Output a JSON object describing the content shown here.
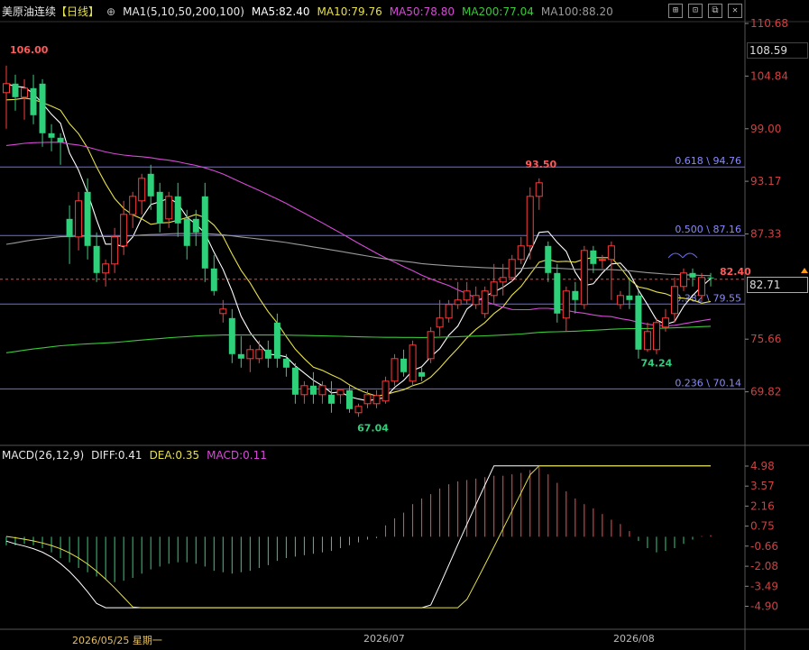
{
  "header": {
    "symbol": "美原油连续",
    "period": "【日线】",
    "settings_icon": "circle-plus-icon",
    "ma_set": "MA1(5,10,50,200,100)",
    "ma5": "MA5:82.40",
    "ma10": "MA10:79.76",
    "ma50": "MA50:78.80",
    "ma200": "MA200:77.04",
    "ma100": "MA100:88.20",
    "colors": {
      "ma5": "#ffffff",
      "ma10": "#e6e04a",
      "ma50": "#d64bd6",
      "ma200": "#39c939",
      "ma100": "#9a9a9a"
    }
  },
  "toolbar": [
    {
      "icon": "grid-icon",
      "label": "⊞"
    },
    {
      "icon": "window-icon",
      "label": "⊡"
    },
    {
      "icon": "dock-icon",
      "label": "⧉"
    },
    {
      "icon": "close-icon",
      "label": "✕"
    }
  ],
  "macd_header": {
    "name": "MACD(26,12,9)",
    "diff": "DIFF:0.41",
    "dea": "DEA:0.35",
    "macd": "MACD:0.11"
  },
  "price_axis": [
    "110.68",
    "104.84",
    "99.00",
    "93.17",
    "87.33",
    "75.66",
    "69.82"
  ],
  "price_boxes": {
    "upper": "108.59",
    "current": "82.71"
  },
  "macd_axis": [
    "4.98",
    "3.57",
    "2.16",
    "0.75",
    "-0.66",
    "-2.08",
    "-3.49",
    "-4.90"
  ],
  "x_labels": [
    "2026/05/25 星期一",
    "2026/07",
    "2026/08"
  ],
  "fib_levels": [
    {
      "label": "0.618 \\ 94.76",
      "value": 94.76
    },
    {
      "label": "0.500 \\ 87.16",
      "value": 87.16
    },
    {
      "label": "0.382 \\ 79.55",
      "value": 79.55
    },
    {
      "label": "0.236 \\ 70.14",
      "value": 70.14
    }
  ],
  "annotations": [
    {
      "label": "106.00",
      "value": 106.0
    },
    {
      "label": "93.50",
      "value": 93.5
    },
    {
      "label": "67.04",
      "value": 67.04
    },
    {
      "label": "74.24",
      "value": 74.24
    },
    {
      "label": "82.40",
      "value": 82.4
    }
  ],
  "chart_data": {
    "type": "candlestick",
    "ylim": [
      67.04,
      110.68
    ],
    "candles": [
      [
        103,
        106,
        99,
        104
      ],
      [
        104,
        105,
        101,
        102.5
      ],
      [
        102.5,
        104.5,
        100,
        103.5
      ],
      [
        103.5,
        105,
        99.5,
        100.5
      ],
      [
        104,
        104.5,
        97,
        98.5
      ],
      [
        98.5,
        99.5,
        96.5,
        98
      ],
      [
        98,
        98.5,
        95,
        97.5
      ],
      [
        89,
        90.5,
        84,
        87
      ],
      [
        87,
        92,
        85.5,
        91
      ],
      [
        92,
        93.5,
        84.5,
        86
      ],
      [
        86,
        87.5,
        82,
        83
      ],
      [
        83,
        84.5,
        81.5,
        84
      ],
      [
        84,
        88,
        83,
        87
      ],
      [
        86,
        91,
        85,
        89.5
      ],
      [
        89.5,
        92,
        88,
        91.5
      ],
      [
        91,
        94,
        89.5,
        93.5
      ],
      [
        94,
        95,
        90,
        91.5
      ],
      [
        92,
        93,
        87.5,
        88.5
      ],
      [
        89,
        92,
        88,
        91.5
      ],
      [
        91.5,
        93,
        87,
        88.5
      ],
      [
        89,
        90,
        84.5,
        86
      ],
      [
        89,
        90,
        86,
        87.5
      ],
      [
        91.5,
        93,
        82,
        83.5
      ],
      [
        83.5,
        85,
        80.5,
        81
      ],
      [
        78.5,
        80,
        77.5,
        79
      ],
      [
        78,
        79,
        73,
        74
      ],
      [
        74,
        76,
        72.5,
        73.5
      ],
      [
        73.5,
        75,
        72,
        74.5
      ],
      [
        73.5,
        75.5,
        73,
        74.5
      ],
      [
        74.5,
        75.5,
        72.5,
        73.5
      ],
      [
        77.5,
        78.5,
        72.5,
        73.5
      ],
      [
        73.5,
        74,
        71.5,
        72.5
      ],
      [
        72.5,
        73,
        68.5,
        69.5
      ],
      [
        69.5,
        71,
        68.5,
        70.5
      ],
      [
        70.5,
        72,
        68.5,
        69.5
      ],
      [
        69.5,
        71,
        68.5,
        70.5
      ],
      [
        69.5,
        71,
        67.5,
        68.5
      ],
      [
        69.5,
        70,
        68.5,
        70
      ],
      [
        70,
        70.5,
        67.5,
        67.9
      ],
      [
        67.5,
        68.5,
        67.04,
        68.2
      ],
      [
        68.5,
        70,
        68,
        69.5
      ],
      [
        68.5,
        70,
        68,
        69.4
      ],
      [
        68.8,
        71.5,
        68.5,
        71
      ],
      [
        71,
        74,
        70.5,
        73.5
      ],
      [
        73.5,
        74.5,
        71.5,
        72
      ],
      [
        71,
        75.5,
        70.5,
        75
      ],
      [
        72,
        72.5,
        71,
        71.5
      ],
      [
        73.5,
        77,
        73,
        76.5
      ],
      [
        77,
        80,
        76,
        78
      ],
      [
        78,
        80,
        77.5,
        79.5
      ],
      [
        79.5,
        82,
        79,
        80
      ],
      [
        80,
        82,
        79.5,
        81
      ],
      [
        79.5,
        81.5,
        79,
        80.5
      ],
      [
        78.5,
        81.5,
        78,
        81
      ],
      [
        80.5,
        84,
        79.5,
        82
      ],
      [
        82,
        84,
        80.5,
        82.5
      ],
      [
        82.5,
        85,
        82,
        84.5
      ],
      [
        84.5,
        87,
        84,
        86
      ],
      [
        86,
        92.5,
        84.5,
        91.5
      ],
      [
        91.5,
        93.5,
        90,
        93
      ],
      [
        86,
        86.5,
        82,
        83
      ],
      [
        83,
        84,
        77.5,
        78.5
      ],
      [
        78,
        81.5,
        76.5,
        81
      ],
      [
        81,
        82,
        78.5,
        80
      ],
      [
        79.5,
        86,
        79,
        85.5
      ],
      [
        85.5,
        86,
        83,
        84
      ],
      [
        84.5,
        85,
        83.5,
        84.5
      ],
      [
        84.5,
        86.5,
        80,
        86
      ],
      [
        79.5,
        81,
        79,
        80.5
      ],
      [
        80.5,
        82.5,
        79,
        80
      ],
      [
        80.5,
        81,
        73.5,
        74.5
      ],
      [
        74.5,
        77.5,
        74.24,
        76.5
      ],
      [
        74.5,
        78,
        74,
        77.5
      ],
      [
        77,
        79,
        76.5,
        78
      ],
      [
        78.5,
        82.5,
        77.5,
        81.5
      ],
      [
        81.5,
        83.5,
        81,
        83
      ],
      [
        83,
        83.5,
        81.5,
        82.5
      ],
      [
        80.5,
        83,
        80,
        82.5
      ],
      [
        82.5,
        83,
        81.5,
        82.4
      ]
    ],
    "macd": {
      "histogram": [
        -0.6,
        -0.6,
        -0.5,
        -0.6,
        -0.8,
        -1.1,
        -1.5,
        -1.8,
        -2.2,
        -2.5,
        -2.8,
        -3.0,
        -3.2,
        -3.1,
        -2.9,
        -2.6,
        -2.3,
        -2.1,
        -1.9,
        -1.8,
        -1.8,
        -1.9,
        -2.1,
        -2.4,
        -2.5,
        -2.6,
        -2.5,
        -2.4,
        -2.2,
        -2.0,
        -1.7,
        -1.5,
        -1.4,
        -1.3,
        -1.2,
        -1.1,
        -1.0,
        -0.8,
        -0.6,
        -0.4,
        -0.2,
        -0.1,
        0.8,
        1.3,
        1.7,
        2.3,
        2.7,
        3.0,
        3.4,
        3.7,
        3.9,
        4.0,
        4.1,
        4.2,
        4.3,
        4.3,
        4.4,
        4.5,
        4.7,
        4.9,
        4.4,
        3.8,
        3.2,
        2.7,
        2.3,
        2.0,
        1.6,
        1.2,
        0.9,
        0.4,
        -0.3,
        -0.8,
        -1.1,
        -1.0,
        -0.8,
        -0.5,
        -0.2,
        0.05,
        0.11
      ],
      "diff_start": -0.1,
      "dea_start": 0.1
    },
    "fib_lines": [
      94.76,
      87.16,
      79.55,
      70.14
    ],
    "current_price": 82.71,
    "last_close": 82.4
  }
}
